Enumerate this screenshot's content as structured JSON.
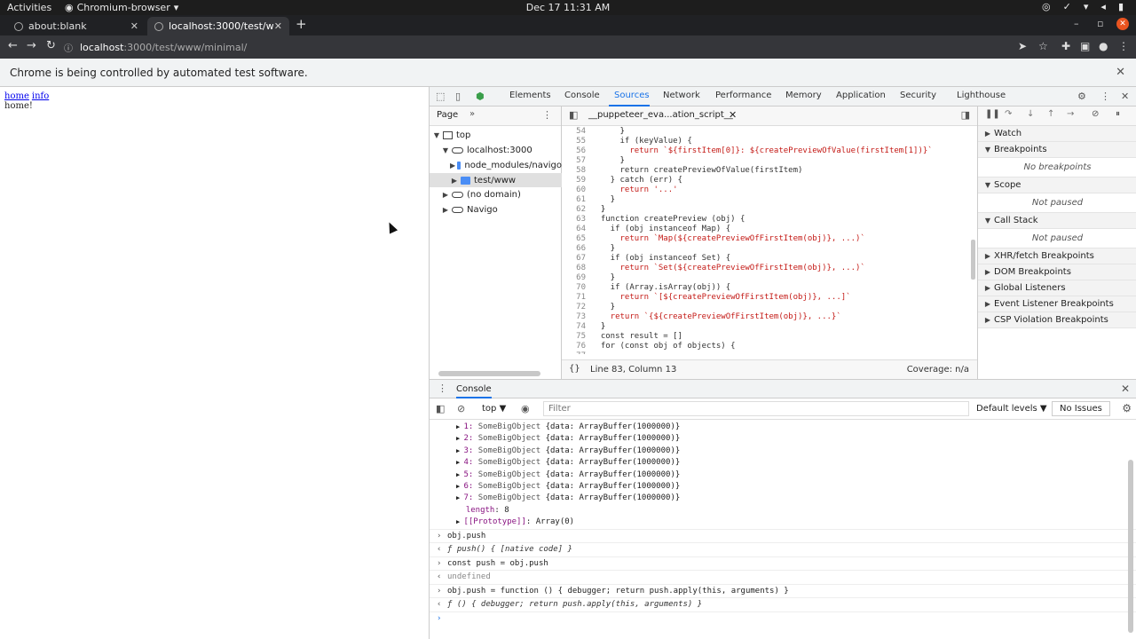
{
  "os": {
    "activities": "Activities",
    "app_name": "Chromium-browser",
    "app_caret": "▾",
    "clock": "Dec 17  11:31 AM"
  },
  "tabs": [
    {
      "title": "about:blank",
      "close": "✕"
    },
    {
      "title": "localhost:3000/test/www/",
      "close": "✕"
    }
  ],
  "new_tab": "+",
  "window_controls": {
    "minimize": "–",
    "restore": "▫",
    "close": "✕"
  },
  "omnibox": {
    "host": "localhost",
    "path": ":3000/test/www/minimal/"
  },
  "infobar": {
    "message": "Chrome is being controlled by automated test software.",
    "close": "✕"
  },
  "page": {
    "links": [
      "home",
      "info"
    ],
    "text": "home!"
  },
  "devtools": {
    "tabs": [
      "Elements",
      "Console",
      "Sources",
      "Network",
      "Performance",
      "Memory",
      "Application",
      "Security",
      "Lighthouse"
    ],
    "active_tab": "Sources",
    "navigator": {
      "tab_label": "Page",
      "more": "»",
      "tree": [
        {
          "label": "top",
          "kind": "frame",
          "tri": "▼"
        },
        {
          "label": "localhost:3000",
          "kind": "cloud",
          "tri": "▼"
        },
        {
          "label": "node_modules/navigo",
          "kind": "folder",
          "tri": "▶"
        },
        {
          "label": "test/www",
          "kind": "folder",
          "tri": "▶"
        },
        {
          "label": "(no domain)",
          "kind": "cloud",
          "tri": "▶"
        },
        {
          "label": "Navigo",
          "kind": "cloud",
          "tri": "▶"
        }
      ]
    },
    "editor": {
      "file_tab": "__puppeteer_eva...ation_script__",
      "status_braces": "{}",
      "position": "Line 83, Column 13",
      "coverage": "Coverage: n/a",
      "lines": [
        {
          "n": "54",
          "code": "      }"
        },
        {
          "n": "55",
          "code": "      if (keyValue) {"
        },
        {
          "n": "56",
          "code": "        return `${firstItem[0]}: ${createPreviewOfValue(firstItem[1])}`"
        },
        {
          "n": "57",
          "code": "      }"
        },
        {
          "n": "58",
          "code": "      return createPreviewOfValue(firstItem)"
        },
        {
          "n": "59",
          "code": "    } catch (err) {"
        },
        {
          "n": "60",
          "code": "      return '...'"
        },
        {
          "n": "61",
          "code": "    }"
        },
        {
          "n": "62",
          "code": "  }"
        },
        {
          "n": "63",
          "code": "  function createPreview (obj) {"
        },
        {
          "n": "64",
          "code": "    if (obj instanceof Map) {"
        },
        {
          "n": "65",
          "code": "      return `Map(${createPreviewOfFirstItem(obj)}, ...)`"
        },
        {
          "n": "66",
          "code": "    }"
        },
        {
          "n": "67",
          "code": "    if (obj instanceof Set) {"
        },
        {
          "n": "68",
          "code": "      return `Set(${createPreviewOfFirstItem(obj)}, ...)`"
        },
        {
          "n": "69",
          "code": "    }"
        },
        {
          "n": "70",
          "code": "    if (Array.isArray(obj)) {"
        },
        {
          "n": "71",
          "code": "      return `[${createPreviewOfFirstItem(obj)}, ...]`"
        },
        {
          "n": "72",
          "code": "    }"
        },
        {
          "n": "73",
          "code": "    return `{${createPreviewOfFirstItem(obj)}, ...}`"
        },
        {
          "n": "74",
          "code": "  }"
        },
        {
          "n": "75",
          "code": "  const result = []"
        },
        {
          "n": "76",
          "code": "  for (const obj of objects) {"
        },
        {
          "n": "77",
          "code": ""
        }
      ]
    },
    "debugger": {
      "sections": [
        {
          "label": "Watch",
          "tri": "▶",
          "empty": ""
        },
        {
          "label": "Breakpoints",
          "tri": "▼",
          "empty": "No breakpoints"
        },
        {
          "label": "Scope",
          "tri": "▼",
          "empty": "Not paused"
        },
        {
          "label": "Call Stack",
          "tri": "▼",
          "empty": "Not paused"
        },
        {
          "label": "XHR/fetch Breakpoints",
          "tri": "▶",
          "empty": ""
        },
        {
          "label": "DOM Breakpoints",
          "tri": "▶",
          "empty": ""
        },
        {
          "label": "Global Listeners",
          "tri": "▶",
          "empty": ""
        },
        {
          "label": "Event Listener Breakpoints",
          "tri": "▶",
          "empty": ""
        },
        {
          "label": "CSP Violation Breakpoints",
          "tri": "▶",
          "empty": ""
        }
      ]
    },
    "console": {
      "drawer_label": "Console",
      "context": "top ▼",
      "filter_placeholder": "Filter",
      "levels": "Default levels ▼",
      "issues": "No Issues",
      "array_items": [
        {
          "idx": "1",
          "cls": "SomeBigObject",
          "val": "{data: ArrayBuffer(1000000)}"
        },
        {
          "idx": "2",
          "cls": "SomeBigObject",
          "val": "{data: ArrayBuffer(1000000)}"
        },
        {
          "idx": "3",
          "cls": "SomeBigObject",
          "val": "{data: ArrayBuffer(1000000)}"
        },
        {
          "idx": "4",
          "cls": "SomeBigObject",
          "val": "{data: ArrayBuffer(1000000)}"
        },
        {
          "idx": "5",
          "cls": "SomeBigObject",
          "val": "{data: ArrayBuffer(1000000)}"
        },
        {
          "idx": "6",
          "cls": "SomeBigObject",
          "val": "{data: ArrayBuffer(1000000)}"
        },
        {
          "idx": "7",
          "cls": "SomeBigObject",
          "val": "{data: ArrayBuffer(1000000)}"
        }
      ],
      "length_key": "length",
      "length_val": ": 8",
      "proto_key": "[[Prototype]]",
      "proto_val": ": Array(0)",
      "entries": [
        {
          "prompt": "›",
          "text": "obj.push",
          "type": "in"
        },
        {
          "prompt": "‹",
          "text": "ƒ push() { [native code] }",
          "type": "fn"
        },
        {
          "prompt": "›",
          "text": "const push = obj.push",
          "type": "in"
        },
        {
          "prompt": "‹",
          "text": "undefined",
          "type": "res"
        },
        {
          "prompt": "›",
          "text": "obj.push = function () { debugger; return push.apply(this, arguments) }",
          "type": "in"
        },
        {
          "prompt": "‹",
          "text": "ƒ () { debugger; return push.apply(this, arguments) }",
          "type": "fn"
        }
      ],
      "input_prompt": "›"
    }
  }
}
